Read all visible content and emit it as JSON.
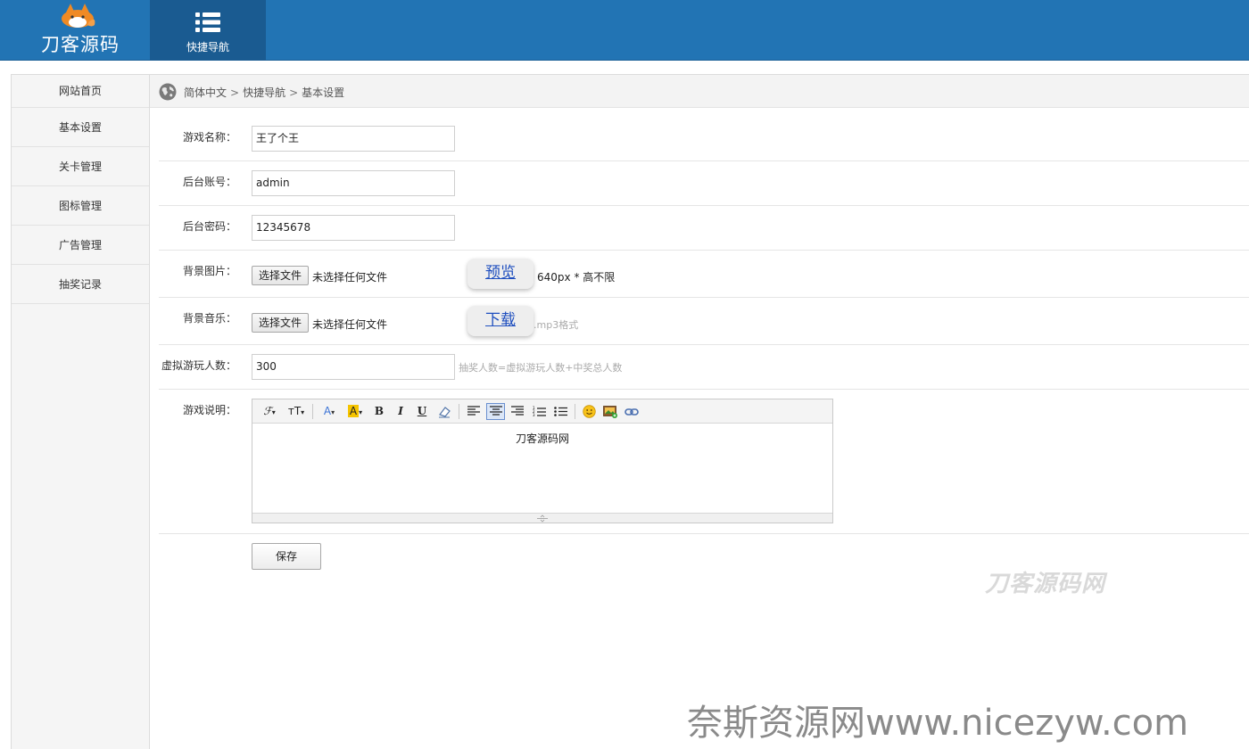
{
  "header": {
    "brand": "刀客源码",
    "nav_tab_label": "快捷导航",
    "colors": {
      "bar": "#2274b4",
      "active_tab": "#1a5b91"
    },
    "icons": {
      "logo": "fox-logo-icon",
      "nav": "list-icon"
    }
  },
  "sidebar": {
    "items": [
      {
        "label": "网站首页"
      },
      {
        "label": "基本设置"
      },
      {
        "label": "关卡管理"
      },
      {
        "label": "图标管理"
      },
      {
        "label": "广告管理"
      },
      {
        "label": "抽奖记录"
      }
    ]
  },
  "breadcrumb": {
    "icon": "globe-icon",
    "parts": [
      "简体中文",
      "快捷导航",
      "基本设置"
    ],
    "separator": ">"
  },
  "form": {
    "game_name": {
      "label": "游戏名称：",
      "value": "王了个王"
    },
    "admin_account": {
      "label": "后台账号：",
      "value": "admin"
    },
    "admin_password": {
      "label": "后台密码：",
      "value": "12345678"
    },
    "bg_image": {
      "label": "背景图片：",
      "button": "选择文件",
      "status": "未选择任何文件",
      "link": "预览",
      "note": "640px * 高不限"
    },
    "bg_music": {
      "label": "背景音乐：",
      "button": "选择文件",
      "status": "未选择任何文件",
      "link": "下载",
      "note": ".mp3格式"
    },
    "virtual_players": {
      "label": "虚拟游玩人数：",
      "value": "300",
      "hint": "抽奖人数=虚拟游玩人数+中奖总人数"
    },
    "description": {
      "label": "游戏说明：",
      "content": "刀客源码网",
      "toolbar": {
        "font_family": "ℱ",
        "font_size": "тT",
        "font_color": "A",
        "back_color": "A",
        "bold": "B",
        "italic": "I",
        "underline": "U"
      }
    },
    "save_label": "保存"
  },
  "watermarks": {
    "site": "刀客源码网",
    "bottom": "奈斯资源网www.nicezyw.com"
  }
}
